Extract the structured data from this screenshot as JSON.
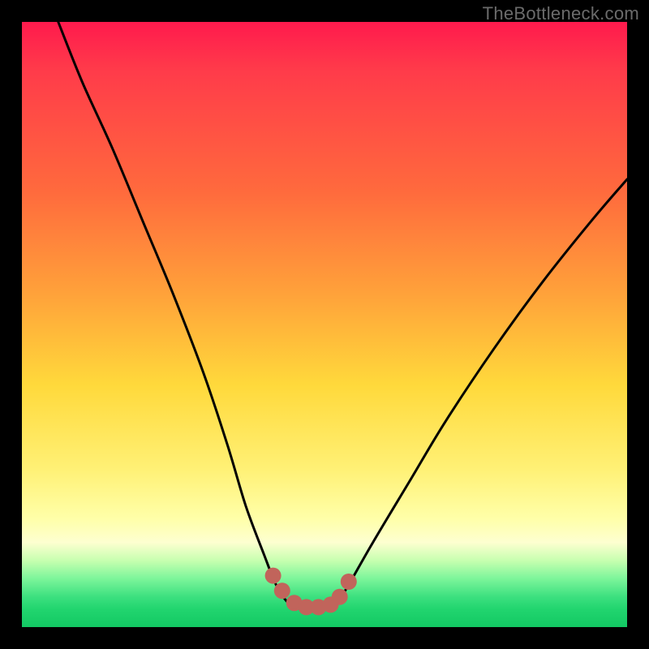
{
  "watermark": "TheBottleneck.com",
  "chart_data": {
    "type": "line",
    "title": "",
    "xlabel": "",
    "ylabel": "",
    "ylim": [
      0,
      100
    ],
    "xlim": [
      0,
      100
    ],
    "series": [
      {
        "name": "bottleneck-curve",
        "x": [
          6,
          10,
          15,
          20,
          25,
          30,
          34,
          37,
          40,
          42,
          44,
          46,
          48,
          50,
          52,
          54,
          58,
          64,
          70,
          78,
          86,
          94,
          100
        ],
        "values": [
          100,
          90,
          79,
          67,
          55,
          42,
          30,
          20,
          12,
          7,
          4,
          3,
          3,
          3,
          4,
          7,
          14,
          24,
          34,
          46,
          57,
          67,
          74
        ]
      }
    ],
    "markers": {
      "name": "trough-dots",
      "color": "#c1645b",
      "x": [
        41.5,
        43,
        45,
        47,
        49,
        51,
        52.5,
        54
      ],
      "values": [
        8.5,
        6,
        4,
        3.3,
        3.3,
        3.7,
        5,
        7.5
      ],
      "radius_px": 10
    }
  },
  "colors": {
    "curve": "#000000",
    "markers": "#c1645b",
    "bg_top": "#ff1a4d",
    "bg_bottom": "#12c963",
    "frame": "#000000"
  }
}
